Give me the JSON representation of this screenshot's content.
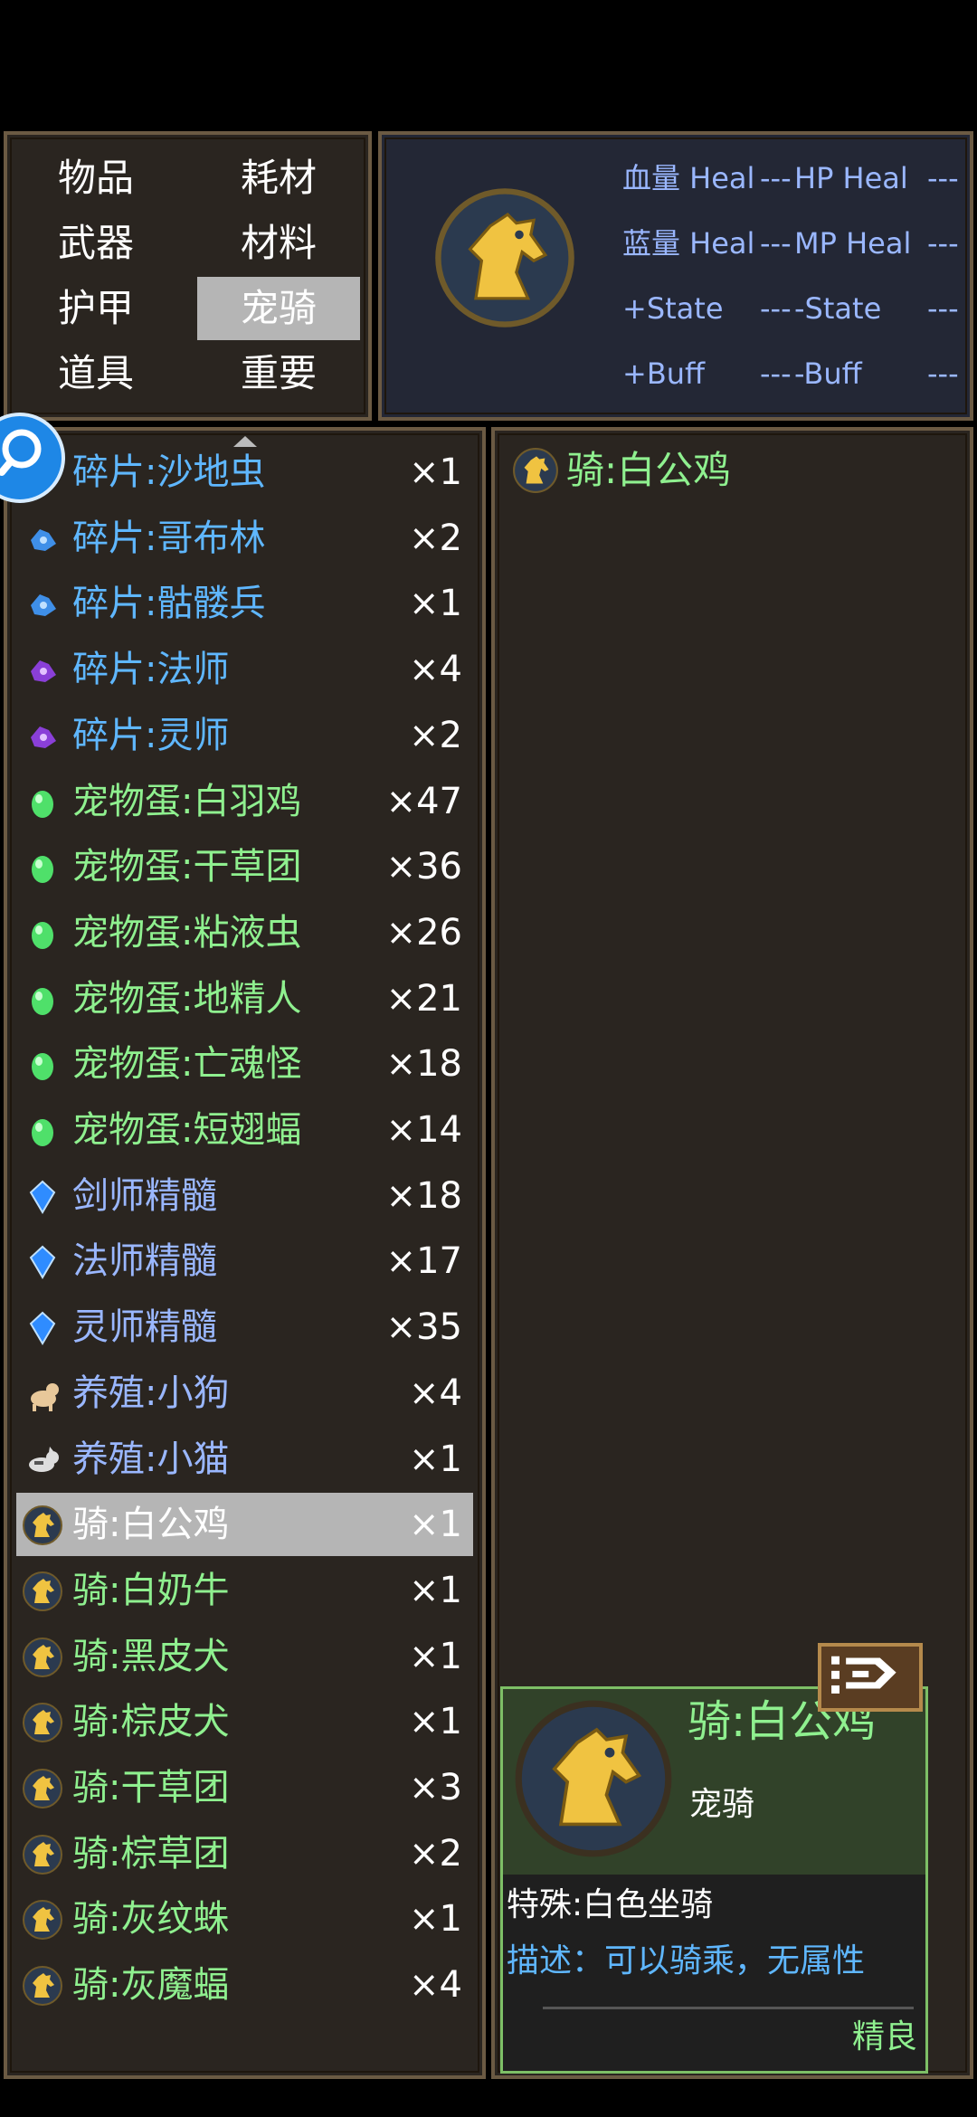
{
  "categories": [
    {
      "label": "物品",
      "selected": false
    },
    {
      "label": "耗材",
      "selected": false
    },
    {
      "label": "武器",
      "selected": false
    },
    {
      "label": "材料",
      "selected": false
    },
    {
      "label": "护甲",
      "selected": false
    },
    {
      "label": "宠骑",
      "selected": true
    },
    {
      "label": "道具",
      "selected": false
    },
    {
      "label": "重要",
      "selected": false
    }
  ],
  "stats": [
    {
      "left": "血量 Heal",
      "left_value": "---",
      "right": "HP Heal",
      "right_value": "---"
    },
    {
      "left": "蓝量 Heal",
      "left_value": "---",
      "right": "MP Heal",
      "right_value": "---"
    },
    {
      "left": "+State",
      "left_value": "---",
      "right": "-State",
      "right_value": "---"
    },
    {
      "left": "+Buff",
      "left_value": "---",
      "right": "-Buff",
      "right_value": "---"
    }
  ],
  "items": [
    {
      "name": "碎片:沙地虫",
      "count": "×1",
      "icon": "blue-shard-icon",
      "color": "#5fb7ff"
    },
    {
      "name": "碎片:哥布林",
      "count": "×2",
      "icon": "blue-shard-icon",
      "color": "#5fb7ff"
    },
    {
      "name": "碎片:骷髅兵",
      "count": "×1",
      "icon": "blue-shard-icon",
      "color": "#5fb7ff"
    },
    {
      "name": "碎片:法师",
      "count": "×4",
      "icon": "purple-shard-icon",
      "color": "#5fb7ff"
    },
    {
      "name": "碎片:灵师",
      "count": "×2",
      "icon": "purple-shard-icon",
      "color": "#5fb7ff"
    },
    {
      "name": "宠物蛋:白羽鸡",
      "count": "×47",
      "icon": "green-egg-icon",
      "color": "#8ff08f"
    },
    {
      "name": "宠物蛋:干草团",
      "count": "×36",
      "icon": "green-egg-icon",
      "color": "#8ff08f"
    },
    {
      "name": "宠物蛋:粘液虫",
      "count": "×26",
      "icon": "green-egg-icon",
      "color": "#8ff08f"
    },
    {
      "name": "宠物蛋:地精人",
      "count": "×21",
      "icon": "green-egg-icon",
      "color": "#8ff08f"
    },
    {
      "name": "宠物蛋:亡魂怪",
      "count": "×18",
      "icon": "green-egg-icon",
      "color": "#8ff08f"
    },
    {
      "name": "宠物蛋:短翅蝠",
      "count": "×14",
      "icon": "green-egg-icon",
      "color": "#8ff08f"
    },
    {
      "name": "剑师精髓",
      "count": "×18",
      "icon": "blue-gem-icon",
      "color": "#9ab7ff"
    },
    {
      "name": "法师精髓",
      "count": "×17",
      "icon": "blue-gem-icon",
      "color": "#9ab7ff"
    },
    {
      "name": "灵师精髓",
      "count": "×35",
      "icon": "blue-gem-icon",
      "color": "#9ab7ff"
    },
    {
      "name": "养殖:小狗",
      "count": "×4",
      "icon": "dog-icon",
      "color": "#9ab7ff"
    },
    {
      "name": "养殖:小猫",
      "count": "×1",
      "icon": "cat-icon",
      "color": "#9ab7ff"
    },
    {
      "name": "骑:白公鸡",
      "count": "×1",
      "icon": "horse-head-icon",
      "color": "#ffffff",
      "selected": true
    },
    {
      "name": "骑:白奶牛",
      "count": "×1",
      "icon": "horse-head-icon",
      "color": "#8ff08f"
    },
    {
      "name": "骑:黑皮犬",
      "count": "×1",
      "icon": "horse-head-icon",
      "color": "#8ff08f"
    },
    {
      "name": "骑:棕皮犬",
      "count": "×1",
      "icon": "horse-head-icon",
      "color": "#8ff08f"
    },
    {
      "name": "骑:干草团",
      "count": "×3",
      "icon": "horse-head-icon",
      "color": "#8ff08f"
    },
    {
      "name": "骑:棕草团",
      "count": "×2",
      "icon": "horse-head-icon",
      "color": "#8ff08f"
    },
    {
      "name": "骑:灰纹蛛",
      "count": "×1",
      "icon": "horse-head-icon",
      "color": "#8ff08f"
    },
    {
      "name": "骑:灰魔蝠",
      "count": "×4",
      "icon": "horse-head-icon",
      "color": "#8ff08f"
    }
  ],
  "detail": {
    "title": "骑:白公鸡",
    "card": {
      "name": "骑:白公鸡",
      "type": "宠骑",
      "special": "特殊:白色坐骑",
      "description": "描述：可以骑乘，无属性",
      "quality": "精良"
    }
  }
}
